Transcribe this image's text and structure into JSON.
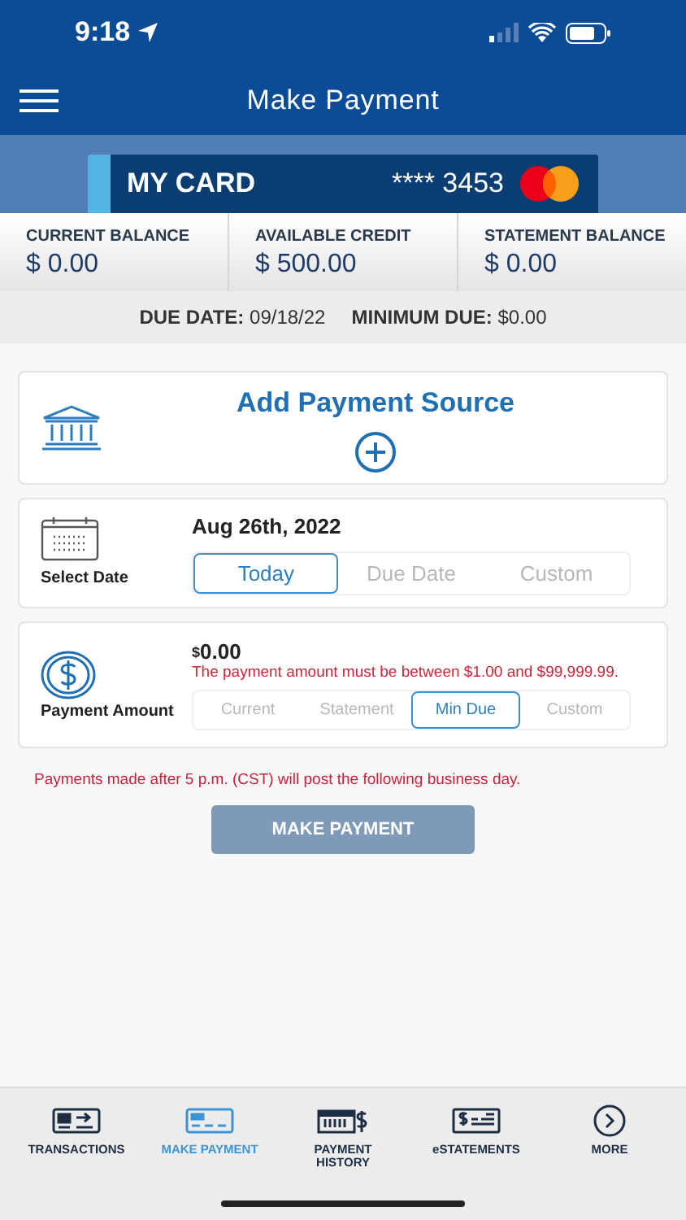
{
  "status_bar": {
    "time": "9:18"
  },
  "header": {
    "title": "Make Payment"
  },
  "card": {
    "name": "MY CARD",
    "number": "**** 3453"
  },
  "balances": [
    {
      "label": "CURRENT BALANCE",
      "value": "$ 0.00"
    },
    {
      "label": "AVAILABLE CREDIT",
      "value": "$ 500.00"
    },
    {
      "label": "STATEMENT BALANCE",
      "value": "$ 0.00"
    }
  ],
  "due": {
    "date_label": "DUE DATE:",
    "date": "09/18/22",
    "min_label": "MINIMUM DUE:",
    "min": "$0.00"
  },
  "payment_source": {
    "title": "Add Payment Source"
  },
  "select_date": {
    "label": "Select Date",
    "date": "Aug 26th, 2022",
    "options": [
      {
        "label": "Today",
        "selected": true
      },
      {
        "label": "Due Date",
        "selected": false
      },
      {
        "label": "Custom",
        "selected": false
      }
    ]
  },
  "payment_amount": {
    "label": "Payment Amount",
    "currency": "$",
    "amount": "0.00",
    "error": "The payment amount must be between $1.00 and $99,999.99.",
    "options": [
      {
        "label": "Current",
        "selected": false
      },
      {
        "label": "Statement",
        "selected": false
      },
      {
        "label": "Min Due",
        "selected": true
      },
      {
        "label": "Custom",
        "selected": false
      }
    ]
  },
  "notice": "Payments made after 5 p.m. (CST) will post the following business day.",
  "make_payment_button": {
    "label": "MAKE PAYMENT",
    "disabled": true
  },
  "tab_bar": [
    {
      "kind": "transactions",
      "label": "TRANSACTIONS",
      "selected": false
    },
    {
      "kind": "payment",
      "label": "MAKE PAYMENT",
      "selected": true
    },
    {
      "kind": "history",
      "label": "PAYMENT HISTORY",
      "selected": false
    },
    {
      "kind": "statements",
      "label": "eSTATEMENTS",
      "selected": false
    },
    {
      "kind": "more",
      "label": "MORE",
      "selected": false
    }
  ]
}
